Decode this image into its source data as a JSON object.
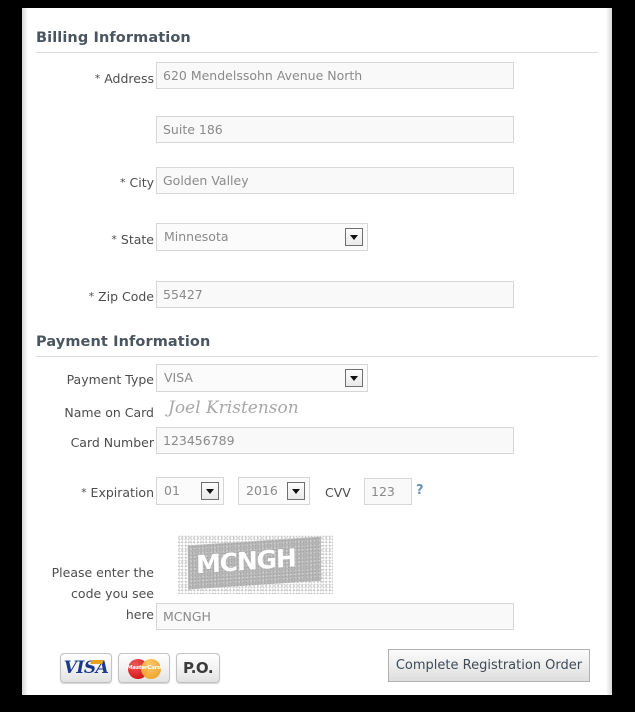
{
  "billing": {
    "heading": "Billing Information",
    "address_label": "Address",
    "address_value": "620 Mendelssohn Avenue North",
    "address2_value": "Suite 186",
    "city_label": "City",
    "city_value": "Golden Valley",
    "state_label": "State",
    "state_value": "Minnesota",
    "zip_label": "Zip Code",
    "zip_value": "55427",
    "required_marker": "*"
  },
  "payment": {
    "heading": "Payment Information",
    "type_label": "Payment Type",
    "type_value": "VISA",
    "name_label": "Name on Card",
    "name_value": "Joel Kristenson",
    "card_label": "Card Number",
    "card_value": "123456789",
    "expiration_label": "Expiration",
    "exp_month_value": "01",
    "exp_year_value": "2016",
    "cvv_label": "CVV",
    "cvv_value": "123",
    "cvv_help": "?",
    "required_marker": "*"
  },
  "captcha": {
    "label_line1": "Please enter the",
    "label_line2": "code you see",
    "label_line3": "here",
    "image_text": "MCNGH",
    "input_value": "MCNGH"
  },
  "footer": {
    "visa_label": "VISA",
    "mastercard_label": "MasterCard",
    "po_label": "P.O.",
    "submit_label": "Complete Registration Order"
  },
  "colors": {
    "heading": "#4b5560",
    "label": "#4d4d4d",
    "field_text": "#8a8a8a",
    "field_bg": "#f9f9f9",
    "field_border": "#d6d6d6",
    "link": "#6f93b8",
    "visa_blue": "#1a3a8f",
    "visa_gold": "#e8a020",
    "mc_red": "#cc0000",
    "mc_orange": "#e8960f"
  }
}
